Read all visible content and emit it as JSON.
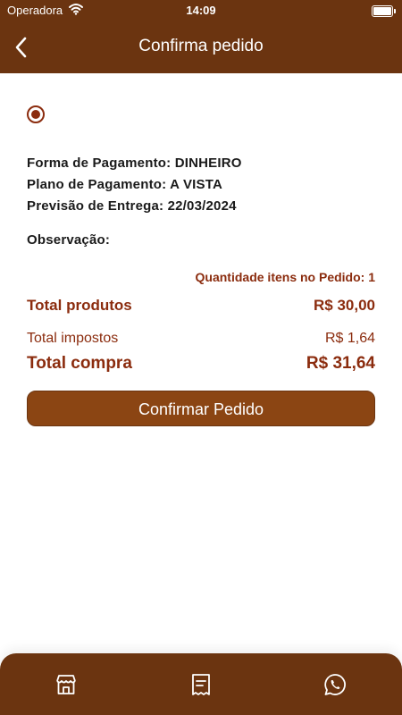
{
  "status_bar": {
    "carrier": "Operadora",
    "time": "14:09"
  },
  "nav": {
    "title": "Confirma pedido",
    "back_icon": "chevron-left-icon"
  },
  "order": {
    "payment_method": "Forma de Pagamento: DINHEIRO",
    "payment_plan": "Plano de Pagamento: A VISTA",
    "delivery_forecast": "Previsão de Entrega: 22/03/2024",
    "observation_label": "Observação:",
    "items_quantity": "Quantidade itens no Pedido: 1"
  },
  "totals": {
    "products_label": "Total produtos",
    "products_value": "R$ 30,00",
    "taxes_label": "Total impostos",
    "taxes_value": "R$ 1,64",
    "purchase_label": "Total compra",
    "purchase_value": "R$ 31,64"
  },
  "actions": {
    "confirm_label": "Confirmar Pedido"
  },
  "bottom_tabs": [
    {
      "icon": "store-icon"
    },
    {
      "icon": "receipt-icon"
    },
    {
      "icon": "whatsapp-icon"
    }
  ],
  "colors": {
    "brand": "#6b3410",
    "accent": "#8b2c0e",
    "button": "#8b4513"
  }
}
